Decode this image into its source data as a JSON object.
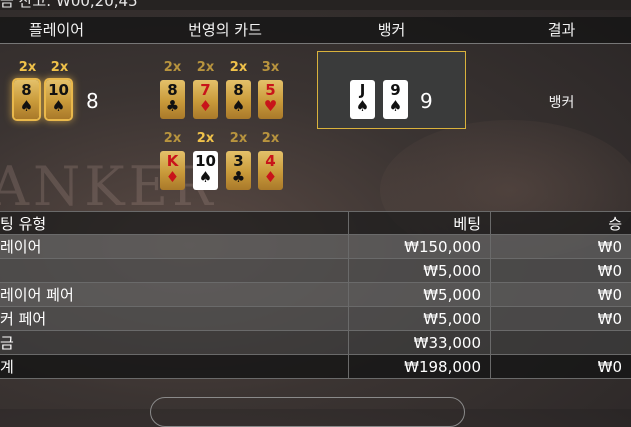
{
  "top_strip": {
    "text": "금 잔고: ₩00,20,45"
  },
  "header": {
    "player": "플레이어",
    "cards_swapped": "번영의 카드",
    "banker": "뱅커",
    "result": "결과"
  },
  "background": {
    "table_text": "ANKER"
  },
  "player_hand": {
    "multipliers": [
      "2x",
      "2x"
    ],
    "cards": [
      {
        "rank": "8",
        "suit": "♠"
      },
      {
        "rank": "10",
        "suit": "♠"
      }
    ],
    "score": "8"
  },
  "lucky_cards": {
    "row1": {
      "multipliers": [
        "2x",
        "2x",
        "2x",
        "3x"
      ],
      "cards": [
        {
          "rank": "8",
          "suit": "♣"
        },
        {
          "rank": "7",
          "suit": "♦"
        },
        {
          "rank": "8",
          "suit": "♠"
        },
        {
          "rank": "5",
          "suit": "♥"
        }
      ]
    },
    "row2": {
      "multipliers": [
        "2x",
        "2x",
        "2x",
        "2x"
      ],
      "cards": [
        {
          "rank": "K",
          "suit": "♦"
        },
        {
          "rank": "10",
          "suit": "♠"
        },
        {
          "rank": "3",
          "suit": "♣"
        },
        {
          "rank": "4",
          "suit": "♦"
        }
      ]
    }
  },
  "banker_hand": {
    "cards": [
      {
        "rank": "J",
        "suit": "♠"
      },
      {
        "rank": "9",
        "suit": "♠"
      }
    ],
    "score": "9"
  },
  "result": {
    "text": "뱅커"
  },
  "bet_table": {
    "headers": {
      "type": "팅 유형",
      "bet": "베팅",
      "win": "승"
    },
    "rows": [
      {
        "type": "레이어",
        "bet": "₩150,000",
        "win": "₩0"
      },
      {
        "type": "",
        "bet": "₩5,000",
        "win": "₩0"
      },
      {
        "type": "레이어 페어",
        "bet": "₩5,000",
        "win": "₩0"
      },
      {
        "type": "커 페어",
        "bet": "₩5,000",
        "win": "₩0"
      },
      {
        "type": "금",
        "bet": "₩33,000",
        "win": ""
      },
      {
        "type": "계",
        "bet": "₩198,000",
        "win": "₩0"
      }
    ]
  },
  "colors": {
    "gold_card": "#d4a84a",
    "highlight": "#e9b84b",
    "red_suit": "#c8141a",
    "banker_border": "#d9b23c"
  }
}
